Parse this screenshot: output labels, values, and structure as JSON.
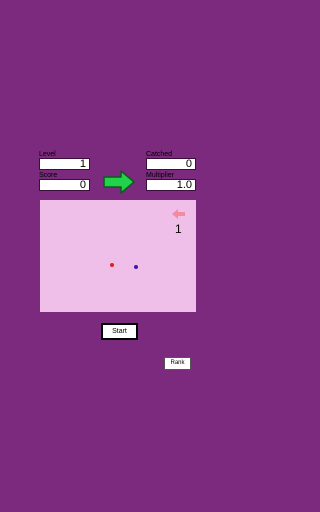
{
  "hud": {
    "level_label": "Level",
    "level_value": "1",
    "score_label": "Score",
    "score_value": "0",
    "caught_label": "Catched",
    "caught_value": "0",
    "multiplier_label": "Multiplier",
    "multiplier_value": "1.0"
  },
  "board": {
    "direction_icon": "left-arrow-icon",
    "count": "1",
    "colors": {
      "background": "#efbfe9",
      "red_dot": "#e0201c",
      "blue_dot": "#3a1ea8",
      "small_arrow": "#f28aa0"
    }
  },
  "controls": {
    "start_label": "Start",
    "rank_label": "Rank",
    "next_arrow_icon": "green-right-arrow-icon",
    "next_arrow_color": "#22d24a"
  },
  "colors": {
    "page_background": "#7b2a7e"
  }
}
